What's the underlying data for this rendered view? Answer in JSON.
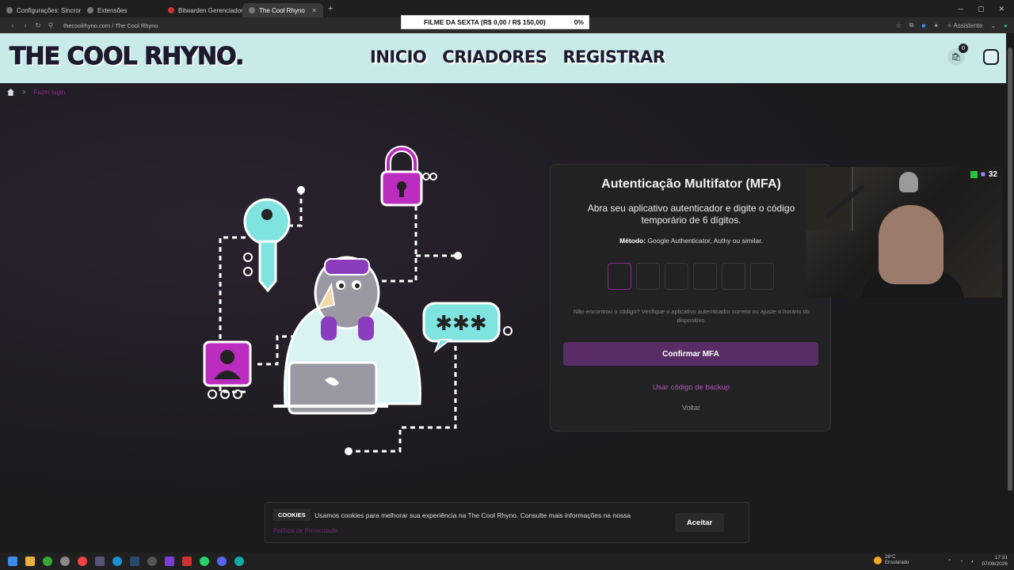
{
  "browser": {
    "tabs": [
      {
        "label": "Configurações: Sincroniza"
      },
      {
        "label": "Extensões"
      },
      {
        "label": "Bitwarden Gerenciador de"
      },
      {
        "label": "The Cool Rhyno"
      }
    ],
    "new_tab": "+",
    "url": "thecoolrhyno.com / The Cool Rhyno",
    "assistant": "Assistente"
  },
  "stream_goal": {
    "label": "FILME DA SEXTA (R$ 0,00 / R$ 150,00)",
    "percent": "0%"
  },
  "site": {
    "logo": "THE COOL RHYNO.",
    "nav": [
      "INICIO",
      "CRIADORES",
      "REGISTRAR"
    ],
    "cart_count": "0"
  },
  "breadcrumb": {
    "separator": ">",
    "current": "Fazer login"
  },
  "mfa": {
    "title": "Autenticação Multifator (MFA)",
    "subtitle": "Abra seu aplicativo autenticador e digite o código temporário de 6 dígitos.",
    "method_label": "Método:",
    "method_value": "Google Authenticator, Authy ou similar.",
    "hint": "Não encontrou o código? Verifique o aplicativo autenticador correto ou ajuste o horário do dispositivo.",
    "confirm_label": "Confirmar MFA",
    "backup_label": "Usar código de backup",
    "back_label": "Voltar"
  },
  "webcam": {
    "viewer_count": "32"
  },
  "cookies": {
    "tag": "COOKIES",
    "text": "Usamos cookies para melhorar sua experiência na The Cool Rhyno. Consulte mais informações na nossa",
    "link": "Política de Privacidade",
    "accept": "Aceitar"
  },
  "taskbar": {
    "weather_temp": "28°C",
    "weather_desc": "Ensolarado",
    "time": "17:31",
    "date": "07/08/2026"
  },
  "colors": {
    "header_bg": "#c8ebea",
    "brand_purple": "#8d2a8f",
    "confirm_bg": "#5a2c66",
    "teal": "#7fe3e0"
  }
}
